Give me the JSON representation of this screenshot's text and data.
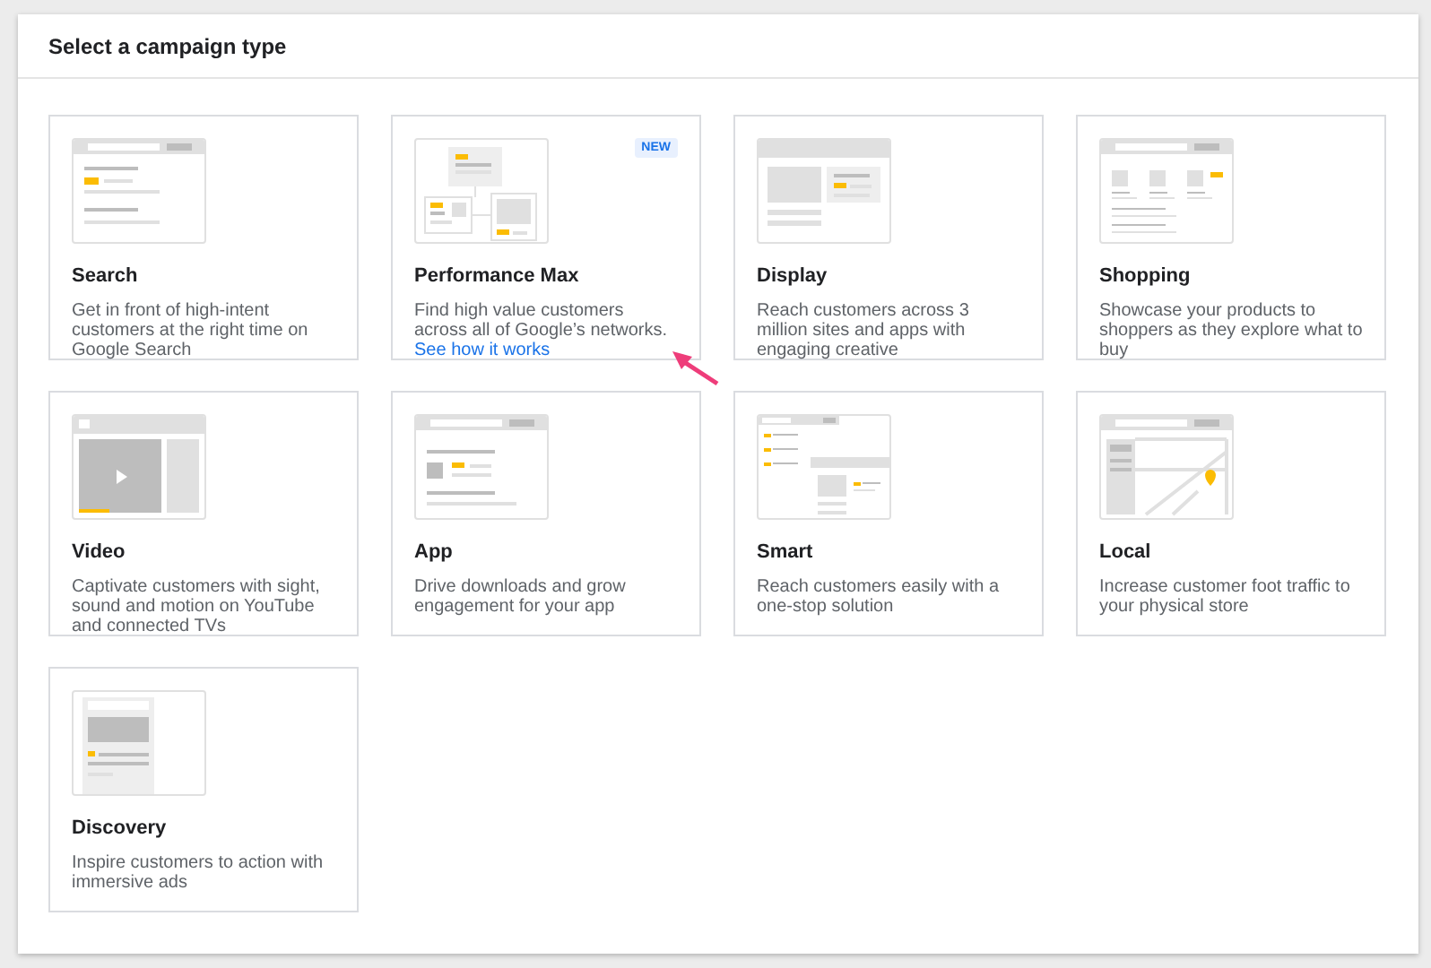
{
  "dialog": {
    "title": "Select a campaign type"
  },
  "campaigns": [
    {
      "kind": "search",
      "name": "Search",
      "description": "Get in front of high-intent customers at the right time on Google Search"
    },
    {
      "kind": "performance",
      "name": "Performance Max",
      "badge": "NEW",
      "description": "Find high value customers across all of Google’s networks.",
      "link": "See how it works"
    },
    {
      "kind": "display",
      "name": "Display",
      "description": "Reach customers across 3 million sites and apps with engaging creative"
    },
    {
      "kind": "shopping",
      "name": "Shopping",
      "description": "Showcase your products to shoppers as they explore what to buy"
    },
    {
      "kind": "video",
      "name": "Video",
      "description": "Captivate customers with sight, sound and motion on YouTube and connected TVs"
    },
    {
      "kind": "app",
      "name": "App",
      "description": "Drive downloads and grow engagement for your app"
    },
    {
      "kind": "smart",
      "name": "Smart",
      "description": "Reach customers easily with a one-stop solution"
    },
    {
      "kind": "local",
      "name": "Local",
      "description": "Increase customer foot traffic to your physical store"
    },
    {
      "kind": "discovery",
      "name": "Discovery",
      "description": "Inspire customers to action with immersive ads"
    }
  ]
}
